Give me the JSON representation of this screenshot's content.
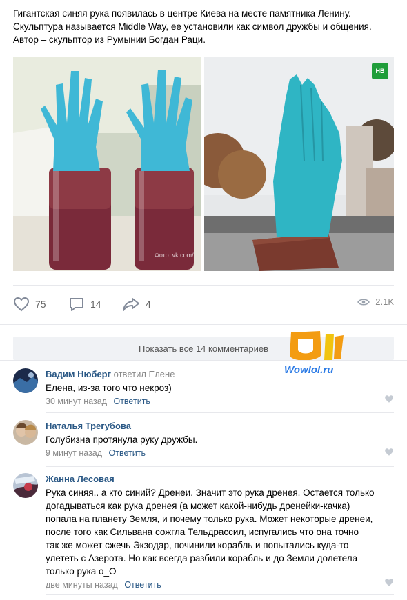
{
  "post": {
    "text_lines": [
      "Гигантская синяя рука появилась в центре Киева на месте памятника Ленину.",
      "Скульптура называется Middle Way, ее установили как символ дружбы и общения.",
      "Автор – скульптор из Румынии Богдан Раци."
    ],
    "photo_credit": "Фото: vk.com/...",
    "badge": "НВ"
  },
  "actions": {
    "likes": "75",
    "comments": "14",
    "shares": "4",
    "views": "2.1K"
  },
  "show_all_label": "Показать все 14 комментариев",
  "watermark": "Wowlol.ru",
  "comments": [
    {
      "author": "Вадим Нюберг",
      "replied": "ответил Елене",
      "text_lines": [
        "Елена, из-за того что некроз)"
      ],
      "time": "30 минут назад",
      "reply_label": "Ответить"
    },
    {
      "author": "Наталья Трегубова",
      "replied": "",
      "text_lines": [
        "Голубизна протянула руку дружбы."
      ],
      "time": "9 минут назад",
      "reply_label": "Ответить"
    },
    {
      "author": "Жанна Лесовая",
      "replied": "",
      "text_lines": [
        "Рука синяя.. а кто синий? Дренеи. Значит это рука дренея. Остается только",
        "догадываться как рука дренея (а может какой-нибудь дренейки-качка)",
        "попала на планету Земля, и почему только рука. Может некоторые дренеи,",
        "после того как Сильвана сожгла Тельдрассил, испугались что она точно",
        "так же может сжечь Экзодар, починили корабль и попытались куда-то",
        "улететь с Азерота. Но как всегда разбили корабль и до Земли долетела",
        "только рука о_О"
      ],
      "time": "две минуты назад",
      "reply_label": "Ответить"
    }
  ],
  "colors": {
    "link": "#2a5885",
    "muted": "#888888",
    "glove": "#3fb8d6",
    "statue": "#2fb5c4"
  }
}
